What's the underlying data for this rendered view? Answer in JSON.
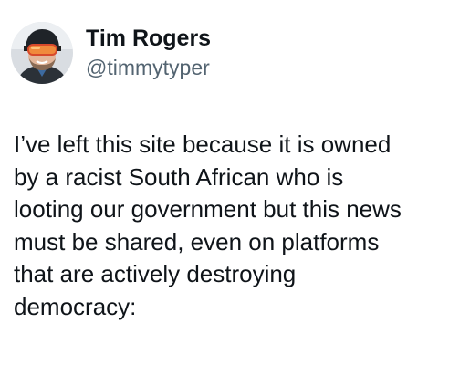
{
  "tweet": {
    "author": {
      "display_name": "Tim Rogers",
      "handle": "@timmytyper",
      "avatar_icon": "avatar-skier-goggles-photo"
    },
    "text": "I’ve left this site because it is owned\nby a racist South African who is\nlooting our government but this news\nmust be shared, even on platforms\nthat are actively destroying\ndemocracy:"
  }
}
